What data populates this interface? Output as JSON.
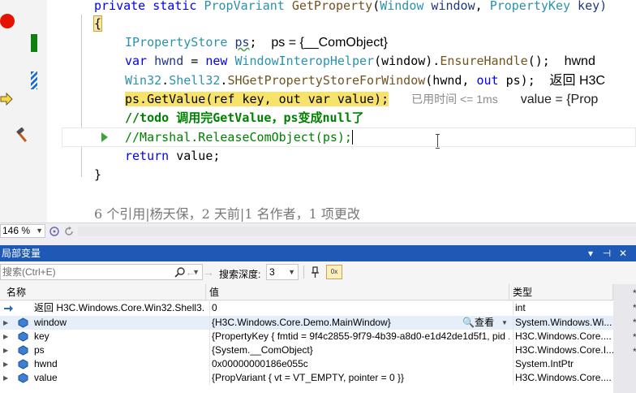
{
  "editor": {
    "lines": {
      "l1": {
        "kw": "private static ",
        "ty": "PropVariant",
        "fn": " GetProperty",
        "p1": "(",
        "ty2": "Window",
        "pa": " window",
        "p2": ", ",
        "ty3": "PropertyKey",
        "pa2": " key)"
      },
      "l2": {
        "brace": "{"
      },
      "l3": {
        "ty": "IPropertyStore",
        "sp": " ",
        "pa": "ps",
        "p": ";",
        "dt": "    ps = {__ComObject}"
      },
      "l4": {
        "kw": "var",
        "pa": " hwnd",
        "p1": " = ",
        "kw2": "new",
        "ty": " WindowInteropHelper",
        "p2": "(window).",
        "fn": "EnsureHandle",
        "p3": "();",
        "dt": "    hwnd"
      },
      "l5": {
        "ty": "Win32",
        "p1": ".",
        "ty2": "Shell32",
        "p2": ".",
        "fn": "SHGetPropertyStoreForWindow",
        "p3": "(hwnd, ",
        "kw": "out",
        "p4": " ps);",
        "dt": "    返回 H3C"
      },
      "l6": {
        "code": "ps.GetValue(ref key, out var value);",
        "hint": "已用时间 <= 1ms",
        "dt": "value = {Prop"
      },
      "l7": {
        "cm": "//todo 调用完GetValue，ps变成null了"
      },
      "l8": {
        "cm": "//Marshal.ReleaseComObject(ps);"
      },
      "l9": {
        "kw": "return",
        "pa": " value",
        "p": ";"
      },
      "l10": {
        "brace": "}"
      }
    },
    "codelens": "6 个引用|杨天保，2 天前|1 名作者，1 项更改"
  },
  "zoom": {
    "value": "146 %"
  },
  "locals": {
    "title": "局部变量",
    "title_buttons": {
      "dropdown": "▾",
      "pin": "⊣",
      "close": "✕"
    },
    "search_placeholder": "搜索(Ctrl+E)",
    "depth_label": "搜索深度:",
    "depth_value": "3",
    "hex_label": "0x",
    "columns": {
      "name": "名称",
      "value": "值",
      "type": "类型"
    },
    "view_label": "查看",
    "rows": [
      {
        "name": "返回 H3C.Windows.Core.Win32.Shell3...",
        "value": "0",
        "type": "int",
        "expander": ""
      },
      {
        "name": "window",
        "value": "{H3C.Windows.Core.Demo.MainWindow}",
        "type": "System.Windows.Wi...",
        "expander": "▶"
      },
      {
        "name": "key",
        "value": "{PropertyKey { fmtid = 9f4c2855-9f79-4b39-a8d0-e1d42de1d5f1, pid ...",
        "type": "H3C.Windows.Core....",
        "expander": "▶"
      },
      {
        "name": "ps",
        "value": "{System.__ComObject}",
        "type": "H3C.Windows.Core.I...",
        "expander": "▶"
      },
      {
        "name": "hwnd",
        "value": "0x00000000186e055c",
        "type": "System.IntPtr",
        "expander": "▶"
      },
      {
        "name": "value",
        "value": "{PropVariant { vt = VT_EMPTY, pointer = 0 }}",
        "type": "H3C.Windows.Core....",
        "expander": "▶"
      }
    ],
    "right_strip": [
      "*",
      "*",
      "*",
      "*",
      "*"
    ]
  },
  "colors": {
    "keyword": "#0000ff",
    "type": "#2b91af",
    "comment": "#008000",
    "title_bar": "#1f59b5",
    "breakpoint": "#e51400",
    "highlight": "#f7e26b"
  }
}
